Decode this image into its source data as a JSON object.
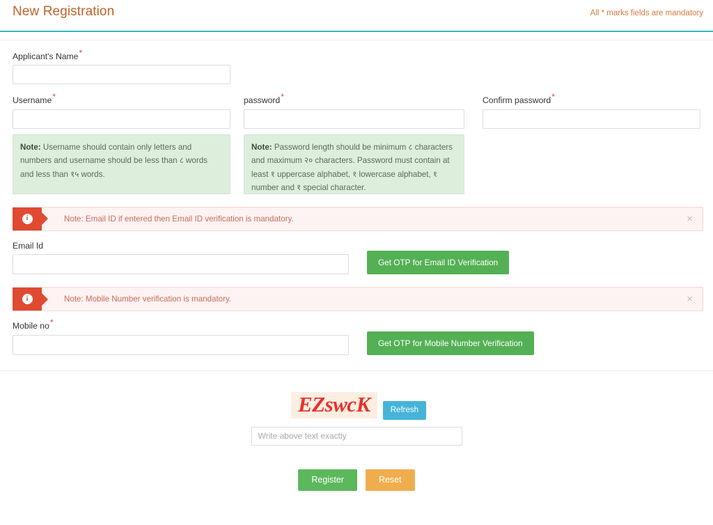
{
  "header": {
    "title": "New Registration",
    "mandatory_note": "All * marks fields are mandatory",
    "accent_underline": "#35b6c4",
    "title_color": "#c0622a"
  },
  "form": {
    "applicant_name": {
      "label": "Applicant's Name",
      "required_mark": "*",
      "value": "",
      "placeholder": ""
    },
    "username": {
      "label": "Username",
      "required_mark": "*",
      "value": "",
      "placeholder": "",
      "note_prefix": "Note:",
      "note_text": " Username should contain only letters and numbers and username should be less than ८ words and less than १५ words."
    },
    "password": {
      "label": "password",
      "required_mark": "*",
      "value": "",
      "placeholder": "",
      "note_prefix": "Note:",
      "note_text": " Password length should be minimum ८ characters and maximum २० characters. Password must contain at least १ uppercase alphabet, १ lowercase alphabet, १ number and १ special character."
    },
    "confirm_password": {
      "label": "Confirm password",
      "required_mark": "*",
      "value": "",
      "placeholder": ""
    },
    "email": {
      "alert_text": "Note: Email ID if entered then Email ID verification is mandatory.",
      "alert_icon": "info-icon",
      "alert_close_icon": "×",
      "label": "Email Id",
      "value": "",
      "placeholder": "",
      "otp_button": "Get OTP for Email ID Verification"
    },
    "mobile": {
      "alert_text": "Note: Mobile Number verification is mandatory.",
      "alert_icon": "info-icon",
      "alert_close_icon": "×",
      "label": "Mobile no",
      "required_mark": "*",
      "value": "",
      "placeholder": "",
      "otp_button": "Get OTP for Mobile Number Verification"
    },
    "captcha": {
      "text": "EZswcK",
      "refresh_button": "Refresh",
      "input_value": "",
      "input_placeholder": "Write above text exactly"
    },
    "actions": {
      "register": "Register",
      "reset": "Reset"
    }
  },
  "colors": {
    "green_button": "#54b054",
    "register_green": "#5cb85c",
    "reset_orange": "#f0ad4e",
    "refresh_blue": "#45b4d8",
    "alert_red": "#e04a32",
    "note_green_bg": "#ddeedd",
    "required_red": "#e8453c",
    "captcha_red": "#e8312a"
  }
}
